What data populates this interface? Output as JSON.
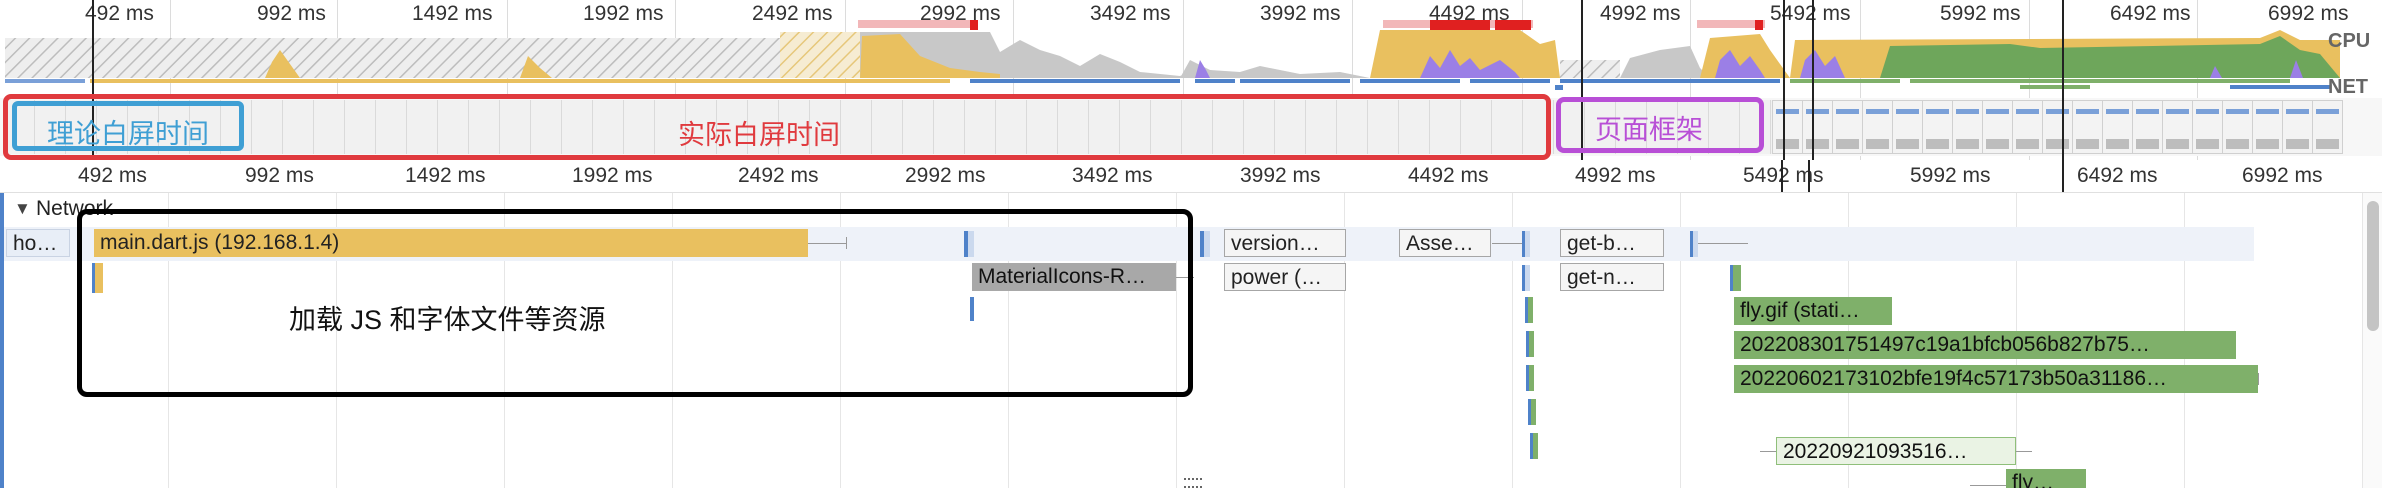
{
  "overview": {
    "time_ticks": [
      "492 ms",
      "992 ms",
      "1492 ms",
      "1992 ms",
      "2492 ms",
      "2992 ms",
      "3492 ms",
      "3992 ms",
      "4492 ms",
      "4992 ms",
      "5492 ms",
      "5992 ms",
      "6492 ms",
      "6992 ms"
    ],
    "cpu_label": "CPU",
    "net_label": "NET"
  },
  "annotations": {
    "theoretical_white_screen": "理论白屏时间",
    "actual_white_screen": "实际白屏时间",
    "page_skeleton": "页面框架",
    "loading_resources": "加载 JS 和字体文件等资源"
  },
  "ruler": {
    "time_ticks": [
      "492 ms",
      "992 ms",
      "1492 ms",
      "1992 ms",
      "2492 ms",
      "2992 ms",
      "3492 ms",
      "3992 ms",
      "4492 ms",
      "4992 ms",
      "5492 ms",
      "5992 ms",
      "6492 ms",
      "6992 ms"
    ]
  },
  "network": {
    "title": "Network",
    "requests": [
      {
        "label": "ho…",
        "type": "doc"
      },
      {
        "label": "main.dart.js (192.168.1.4)",
        "type": "script"
      },
      {
        "label": "version…",
        "type": "xhr"
      },
      {
        "label": "Asse…",
        "type": "xhr"
      },
      {
        "label": "get-b…",
        "type": "xhr"
      },
      {
        "label": "MaterialIcons-R…",
        "type": "font"
      },
      {
        "label": "power (…",
        "type": "xhr"
      },
      {
        "label": "get-n…",
        "type": "xhr"
      },
      {
        "label": "fly.gif (stati…",
        "type": "img"
      },
      {
        "label": "202208301751497c19a1bfcb056b827b75…",
        "type": "img"
      },
      {
        "label": "20220602173102bfe19f4c57173b50a31186…",
        "type": "img"
      },
      {
        "label": "20220921093516…",
        "type": "imgpale"
      },
      {
        "label": "fly…",
        "type": "img"
      }
    ]
  },
  "colors": {
    "annotation_blue": "#3f9fd4",
    "annotation_red": "#e03a3e",
    "annotation_purple": "#b84fd6",
    "annotation_black": "#000000",
    "cpu_scripting": "#e9c05f",
    "cpu_rendering": "#9b7fe6",
    "cpu_painting": "#6ea65b",
    "cpu_idle": "#c8c8c8"
  }
}
